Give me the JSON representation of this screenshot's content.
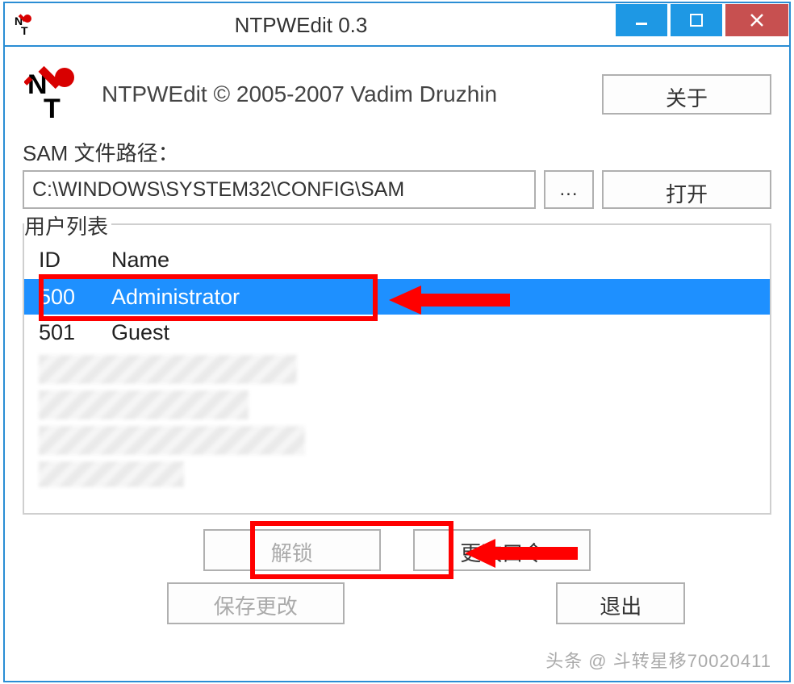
{
  "window": {
    "title": "NTPWEdit 0.3"
  },
  "about": {
    "copyright": "NTPWEdit © 2005-2007 Vadim Druzhin",
    "about_btn": "关于"
  },
  "path": {
    "label": "SAM 文件路径：",
    "value": "C:\\WINDOWS\\SYSTEM32\\CONFIG\\SAM",
    "browse": "...",
    "open": "打开"
  },
  "userlist": {
    "label": "用户列表",
    "col_id": "ID",
    "col_name": "Name",
    "rows": [
      {
        "id": "500",
        "name": "Administrator",
        "selected": true
      },
      {
        "id": "501",
        "name": "Guest",
        "selected": false
      }
    ]
  },
  "buttons": {
    "unlock": "解锁",
    "change_pw": "更改口令",
    "save": "保存更改",
    "exit": "退出"
  },
  "watermark": "头条 @ 斗转星移70020411"
}
